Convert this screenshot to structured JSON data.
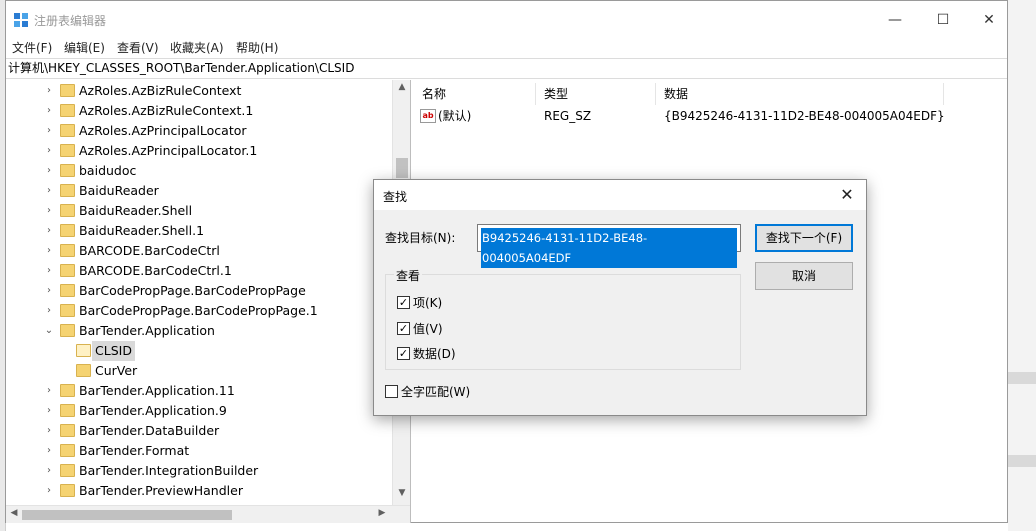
{
  "window": {
    "title": "注册表编辑器",
    "minimize": "—",
    "maximize": "☐",
    "close": "✕"
  },
  "menu": [
    "文件(F)",
    "编辑(E)",
    "查看(V)",
    "收藏夹(A)",
    "帮助(H)"
  ],
  "address": "计算机\\HKEY_CLASSES_ROOT\\BarTender.Application\\CLSID",
  "tree": [
    {
      "label": "AzRoles.AzBizRuleContext",
      "expander": "›"
    },
    {
      "label": "AzRoles.AzBizRuleContext.1",
      "expander": "›"
    },
    {
      "label": "AzRoles.AzPrincipalLocator",
      "expander": "›"
    },
    {
      "label": "AzRoles.AzPrincipalLocator.1",
      "expander": "›"
    },
    {
      "label": "baidudoc",
      "expander": "›"
    },
    {
      "label": "BaiduReader",
      "expander": "›"
    },
    {
      "label": "BaiduReader.Shell",
      "expander": "›"
    },
    {
      "label": "BaiduReader.Shell.1",
      "expander": "›"
    },
    {
      "label": "BARCODE.BarCodeCtrl",
      "expander": "›"
    },
    {
      "label": "BARCODE.BarCodeCtrl.1",
      "expander": "›"
    },
    {
      "label": "BarCodePropPage.BarCodePropPage",
      "expander": "›"
    },
    {
      "label": "BarCodePropPage.BarCodePropPage.1",
      "expander": "›"
    },
    {
      "label": "BarTender.Application",
      "expander": "⌄"
    },
    {
      "label": "CLSID",
      "expander": ""
    },
    {
      "label": "CurVer",
      "expander": ""
    },
    {
      "label": "BarTender.Application.11",
      "expander": "›"
    },
    {
      "label": "BarTender.Application.9",
      "expander": "›"
    },
    {
      "label": "BarTender.DataBuilder",
      "expander": "›"
    },
    {
      "label": "BarTender.Format",
      "expander": "›"
    },
    {
      "label": "BarTender.IntegrationBuilder",
      "expander": "›"
    },
    {
      "label": "BarTender.PreviewHandler",
      "expander": "›"
    }
  ],
  "values": {
    "columns": [
      "名称",
      "类型",
      "数据"
    ],
    "rows": [
      {
        "name": "(默认)",
        "type": "REG_SZ",
        "data": "{B9425246-4131-11D2-BE48-004005A04EDF}",
        "icon": "ab"
      }
    ]
  },
  "find_dialog": {
    "title": "查找",
    "close": "✕",
    "target_label": "查找目标(N):",
    "target_value": "B9425246-4131-11D2-BE48-004005A04EDF",
    "find_next": "查找下一个(F)",
    "cancel": "取消",
    "look_at_title": "查看",
    "options": [
      {
        "label": "项(K)",
        "checked": true
      },
      {
        "label": "值(V)",
        "checked": true
      },
      {
        "label": "数据(D)",
        "checked": true
      }
    ],
    "whole_match": {
      "label": "全字匹配(W)",
      "checked": false
    }
  },
  "colors": {
    "accent": "#0078d7",
    "folder": "#f5d372",
    "selected_row": "#d9d9d9"
  }
}
